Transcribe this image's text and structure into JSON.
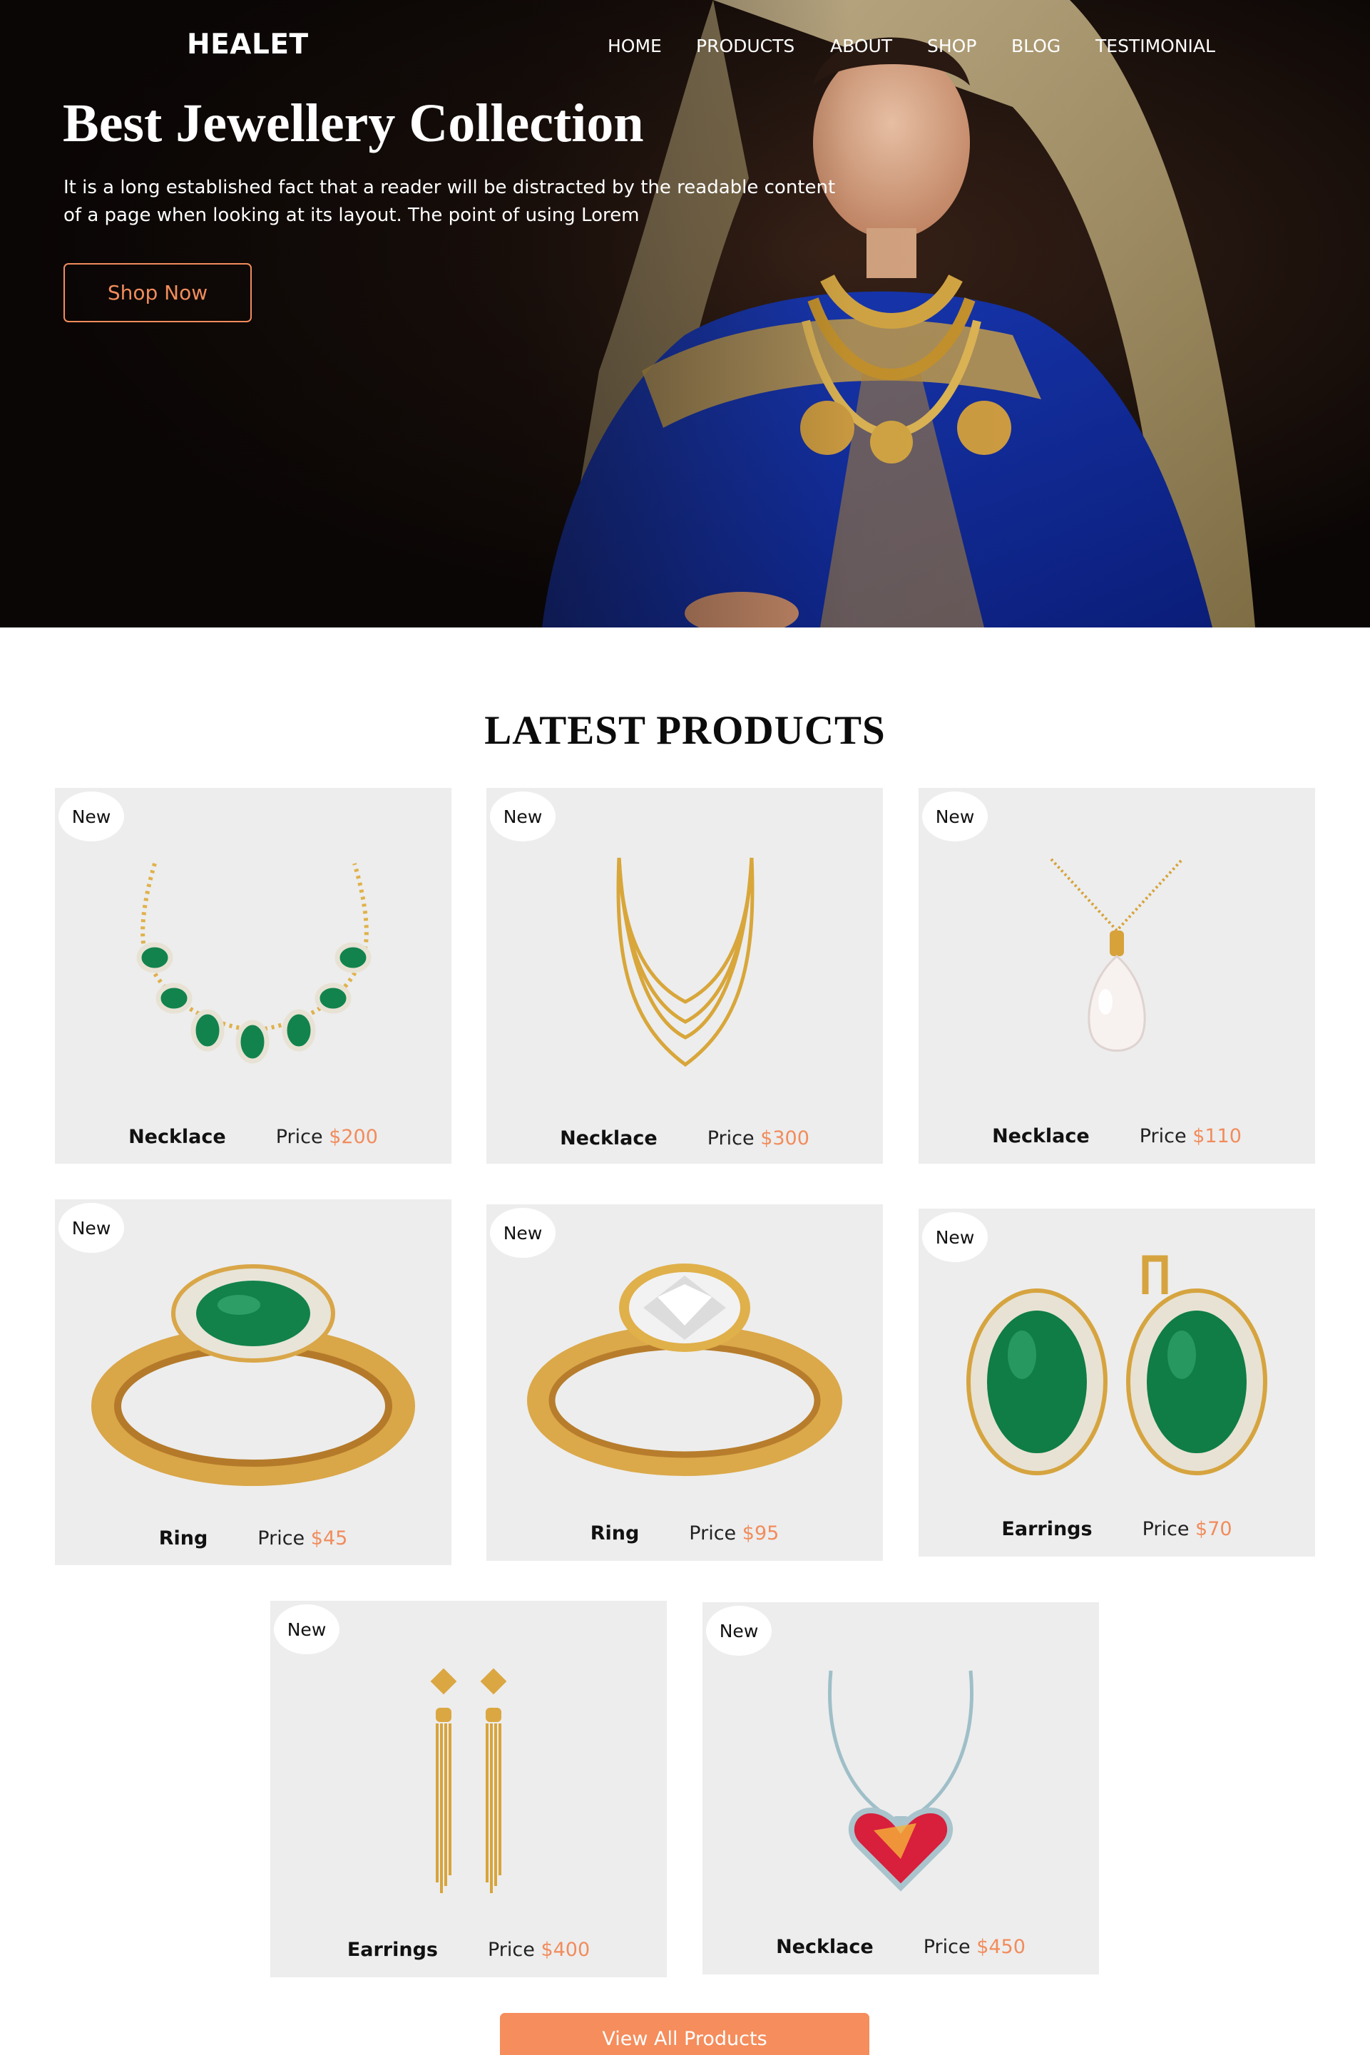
{
  "brand": {
    "logo": "HEALET"
  },
  "nav": {
    "items": [
      {
        "label": "HOME"
      },
      {
        "label": "PRODUCTS"
      },
      {
        "label": "ABOUT"
      },
      {
        "label": "SHOP"
      },
      {
        "label": "BLOG"
      },
      {
        "label": "TESTIMONIAL"
      }
    ]
  },
  "hero": {
    "title": "Best Jewellery Collection",
    "description": "It is a long established fact that a reader will be distracted by the readable content of a page when looking at its layout. The point of using Lorem",
    "button": "Shop Now"
  },
  "section": {
    "title": "LATEST PRODUCTS"
  },
  "products": [
    {
      "badge": "New",
      "name": "Necklace",
      "price_label": "Price",
      "price": "$200",
      "art": "emerald-necklace"
    },
    {
      "badge": "New",
      "name": "Necklace",
      "price_label": "Price",
      "price": "$300",
      "art": "gold-chain-necklace"
    },
    {
      "badge": "New",
      "name": "Necklace",
      "price_label": "Price",
      "price": "$110",
      "art": "pearl-pendant-necklace"
    },
    {
      "badge": "New",
      "name": "Ring",
      "price_label": "Price",
      "price": "$45",
      "art": "emerald-ring"
    },
    {
      "badge": "New",
      "name": "Ring",
      "price_label": "Price",
      "price": "$95",
      "art": "diamond-ring"
    },
    {
      "badge": "New",
      "name": "Earrings",
      "price_label": "Price",
      "price": "$70",
      "art": "emerald-earrings"
    },
    {
      "badge": "New",
      "name": "Earrings",
      "price_label": "Price",
      "price": "$400",
      "art": "gold-drop-earrings"
    },
    {
      "badge": "New",
      "name": "Necklace",
      "price_label": "Price",
      "price": "$450",
      "art": "ruby-heart-necklace"
    }
  ],
  "footer_button": "View All Products",
  "colors": {
    "accent": "#f18c5c",
    "card_bg": "#ededed",
    "button_bg": "#f58d5c"
  }
}
